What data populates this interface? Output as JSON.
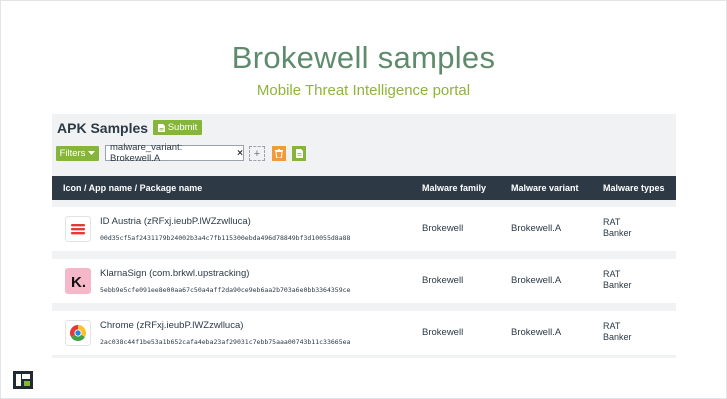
{
  "header": {
    "title": "Brokewell samples",
    "subtitle": "Mobile Threat Intelligence portal"
  },
  "toolbar": {
    "section_title": "APK Samples",
    "submit_label": "Submit",
    "filters_label": "Filters",
    "filter_tag": "malware_variant: Brokewell.A",
    "add_label": "+"
  },
  "table": {
    "headers": [
      "Icon / App name / Package name",
      "Malware family",
      "Malware variant",
      "Malware types"
    ],
    "rows": [
      {
        "name": "ID Austria (zRFxj.ieubP.lWZzwlluca)",
        "hash": "00d35cf5af2431179b24002b3a4c7fb115300ebda496d78849bf3d10055d8a88",
        "family": "Brokewell",
        "variant": "Brokewell.A",
        "types": [
          "RAT",
          "Banker"
        ],
        "icon": "id-austria-icon"
      },
      {
        "name": "KlarnaSign (com.brkwl.upstracking)",
        "hash": "5ebb9e5cfe091ee8e00aa67c50a4aff2da90ce9eb6aa2b703a6e0bb3364359ce",
        "family": "Brokewell",
        "variant": "Brokewell.A",
        "types": [
          "RAT",
          "Banker"
        ],
        "icon": "klarna-icon"
      },
      {
        "name": "Chrome (zRFxj.ieubP.lWZzwlluca)",
        "hash": "2ac038c44f1be53a1b652cafa4eba23af29031c7ebb75aaa00743b11c33665ea",
        "family": "Brokewell",
        "variant": "Brokewell.A",
        "types": [
          "RAT",
          "Banker"
        ],
        "icon": "chrome-icon"
      }
    ]
  },
  "colors": {
    "accent_green": "#86b53b",
    "title_green": "#5e8b6b",
    "header_dark": "#2d3a45",
    "orange": "#f39b3a"
  }
}
